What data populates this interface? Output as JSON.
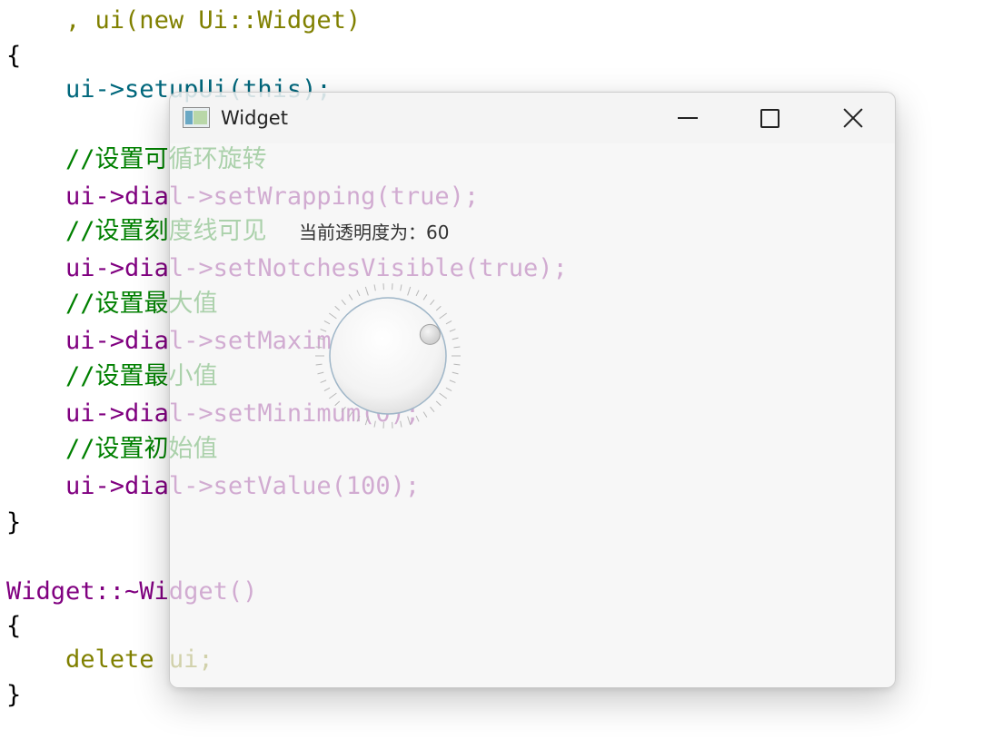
{
  "code": {
    "lines": [
      ", ui(new Ui::Widget)",
      "{",
      "ui->setupUi(this);",
      "//设置可循环旋转",
      "ui->dial->setWrapping(true);",
      "//设置刻度线可见",
      "ui->dial->setNotchesVisible(true);",
      "//设置最大值",
      "ui->dial->setMaximum(100);",
      "//设置最小值",
      "ui->dial->setMinimum(0);",
      "//设置初始值",
      "ui->dial->setValue(100);",
      "}",
      "Widget::~Widget()",
      "{",
      "delete ui;",
      "}"
    ]
  },
  "window": {
    "title": "Widget",
    "icon": "app-window-icon",
    "controls": [
      "minimize-icon",
      "maximize-icon",
      "close-icon"
    ],
    "opacity_label": "当前透明度为：60",
    "background_color": "#f4f4f4"
  },
  "dial": {
    "value": 100,
    "minimum": 0,
    "maximum": 100,
    "wrapping": true,
    "notches_visible": true
  }
}
